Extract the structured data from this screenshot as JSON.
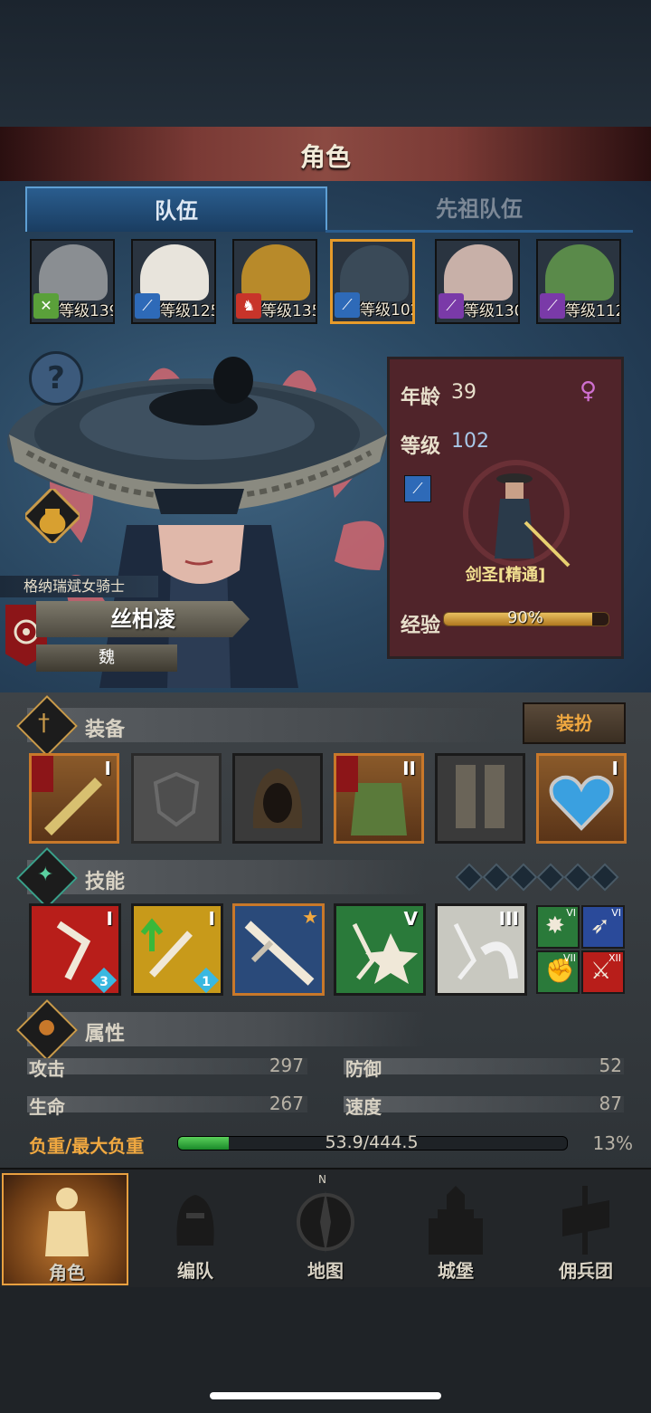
{
  "title": "角色",
  "tabs": [
    {
      "label": "队伍",
      "active": true
    },
    {
      "label": "先祖队伍",
      "active": false
    }
  ],
  "heroes": [
    {
      "level_text": "等级139",
      "class_color": "#5aa03a",
      "face_color": "#8a8e92",
      "selected": false
    },
    {
      "level_text": "等级125",
      "class_color": "#2e6ab8",
      "face_color": "#e8e4dc",
      "selected": false
    },
    {
      "level_text": "等级135",
      "class_color": "#c8342a",
      "face_color": "#b88a2a",
      "selected": false
    },
    {
      "level_text": "等级102",
      "class_color": "#2e6ab8",
      "face_color": "#3a4a58",
      "selected": true
    },
    {
      "level_text": "等级130",
      "class_color": "#7a3aa8",
      "face_color": "#c8b0a8",
      "selected": false
    },
    {
      "level_text": "等级112",
      "class_color": "#7a3aa8",
      "face_color": "#5a8a4a",
      "selected": false
    }
  ],
  "character": {
    "help_label": "?",
    "subtitle": "格纳瑞斌女骑士",
    "name": "丝柏凌",
    "nation": "魏",
    "age_label": "年龄",
    "age": "39",
    "level_label": "等级",
    "level": "102",
    "class_name": "剑圣[精通]",
    "exp_label": "经验",
    "exp_text": "90%",
    "exp_fraction": 0.9
  },
  "equipment": {
    "title": "装备",
    "dress_button": "装扮",
    "slots": [
      {
        "roman": "I",
        "type": "orange"
      },
      {
        "roman": "",
        "type": "plain"
      },
      {
        "roman": "",
        "type": "dark"
      },
      {
        "roman": "II",
        "type": "orange"
      },
      {
        "roman": "",
        "type": "dark"
      },
      {
        "roman": "I",
        "type": "orange"
      }
    ]
  },
  "skills": {
    "title": "技能",
    "items": [
      {
        "roman": "I",
        "badge": "3",
        "color": "#b81e1a"
      },
      {
        "roman": "I",
        "badge": "1",
        "color": "#c89a1a"
      },
      {
        "roman": "",
        "badge": "",
        "color": "#2a4a7a"
      },
      {
        "roman": "V",
        "badge": "",
        "color": "#2a7a3a"
      },
      {
        "roman": "III",
        "badge": "",
        "color": "#c8c8c0"
      }
    ],
    "mini": [
      {
        "roman": "VI",
        "color": "#2a7a3a"
      },
      {
        "roman": "VI",
        "color": "#2a4a9a"
      },
      {
        "roman": "VII",
        "color": "#2a7a3a"
      },
      {
        "roman": "XII",
        "color": "#b81e1a"
      }
    ]
  },
  "attributes": {
    "title": "属性",
    "attack_label": "攻击",
    "attack": "297",
    "defense_label": "防御",
    "defense": "52",
    "hp_label": "生命",
    "hp": "267",
    "speed_label": "速度",
    "speed": "87",
    "load_label": "负重/最大负重",
    "load_text": "53.9/444.5",
    "load_percent": "13%",
    "load_fraction": 0.13
  },
  "nav": [
    {
      "label": "角色",
      "active": true
    },
    {
      "label": "编队",
      "active": false
    },
    {
      "label": "地图",
      "active": false,
      "compass": "N"
    },
    {
      "label": "城堡",
      "active": false
    },
    {
      "label": "佣兵团",
      "active": false
    }
  ]
}
